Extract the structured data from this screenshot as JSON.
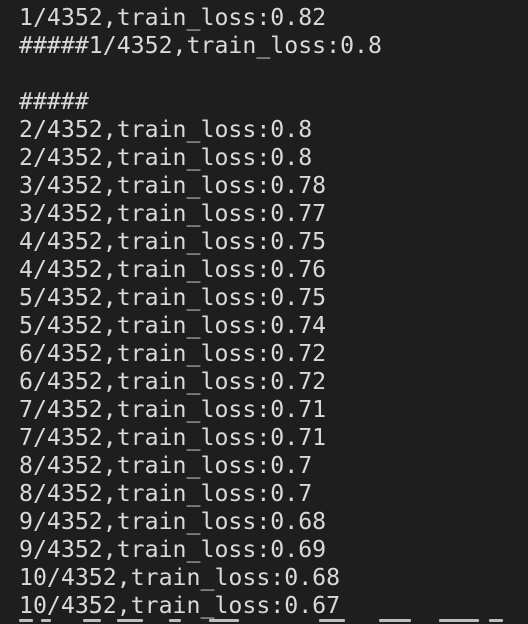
{
  "terminal": {
    "lines": [
      "1/4352,train_loss:0.82",
      "#####1/4352,train_loss:0.8",
      "",
      "#####",
      "2/4352,train_loss:0.8",
      "2/4352,train_loss:0.8",
      "3/4352,train_loss:0.78",
      "3/4352,train_loss:0.77",
      "4/4352,train_loss:0.75",
      "4/4352,train_loss:0.76",
      "5/4352,train_loss:0.75",
      "5/4352,train_loss:0.74",
      "6/4352,train_loss:0.72",
      "6/4352,train_loss:0.72",
      "7/4352,train_loss:0.71",
      "7/4352,train_loss:0.71",
      "8/4352,train_loss:0.7",
      "8/4352,train_loss:0.7",
      "9/4352,train_loss:0.68",
      "9/4352,train_loss:0.69",
      "10/4352,train_loss:0.68",
      "10/4352,train_loss:0.67"
    ]
  },
  "colors": {
    "background": "#1e1e1e",
    "text": "#d9d9d9"
  }
}
